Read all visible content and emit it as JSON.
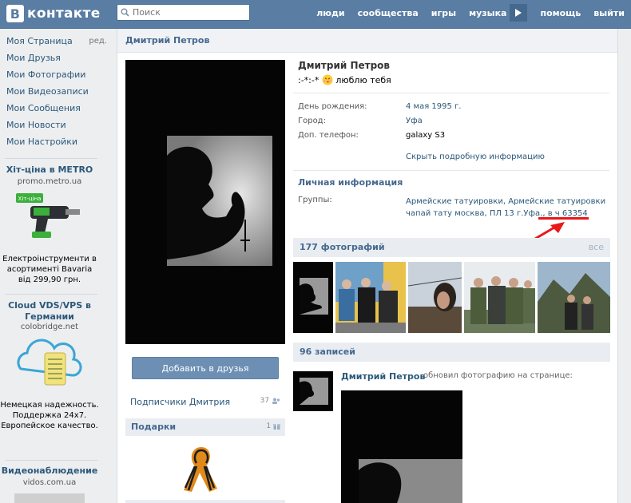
{
  "header": {
    "logo_text": "контакте",
    "logo_letter": "В",
    "search_placeholder": "Поиск",
    "nav": [
      "люди",
      "сообщества",
      "игры",
      "музыка",
      "помощь",
      "выйти"
    ],
    "brand_color": "#597da3"
  },
  "sidebar": {
    "items": [
      "Моя Страница",
      "Мои Друзья",
      "Мои Фотографии",
      "Мои Видеозаписи",
      "Мои Сообщения",
      "Мои Новости",
      "Мои Настройки"
    ],
    "edit_label": "ред.",
    "ads": [
      {
        "title": "Хіт-ціна в METRO",
        "site": "promo.metro.ua",
        "badge": "Хіт-ціна",
        "text": "Електроінструменти в асортименті Bavaria від 299,90 грн."
      },
      {
        "title": "Cloud VDS/VPS в Германии",
        "site": "colobridge.net",
        "text": "Немецкая надежность. Поддержка 24x7. Европейское качество."
      },
      {
        "title": "Видеонаблюдение",
        "site": "vidos.com.ua"
      }
    ]
  },
  "profile": {
    "page_title": "Дмитрий Петров",
    "name": "Дмитрий Петров",
    "status_prefix": ":-*:-*",
    "status_suffix": "люблю тебя",
    "fields": [
      {
        "label": "День рождения:",
        "value": "4 мая 1995 г."
      },
      {
        "label": "Город:",
        "value": "Уфа"
      },
      {
        "label": "Доп. телефон:",
        "value": "galaxy S3"
      }
    ],
    "full_info_link": "Скрыть подробную информацию",
    "personal_title": "Личная информация",
    "groups_label": "Группы:",
    "groups": [
      "Армейские татуировки",
      "Армейские татуировки чапай тату москва",
      "ПЛ 13 г.Уфа.",
      "в ч 63354"
    ],
    "groups_sep": ", ",
    "add_friend": "Добавить в друзья",
    "followers_label": "Подписчики Дмитрия",
    "followers_count": "37",
    "gifts_label": "Подарки",
    "gifts_count": "1",
    "photos_title": "177 фотографий",
    "photos_all": "все",
    "posts_title": "96 записей",
    "post_author": "Дмитрий Петров",
    "post_action": "обновил фотографию на странице:"
  },
  "annotation_color": "#e8181b"
}
